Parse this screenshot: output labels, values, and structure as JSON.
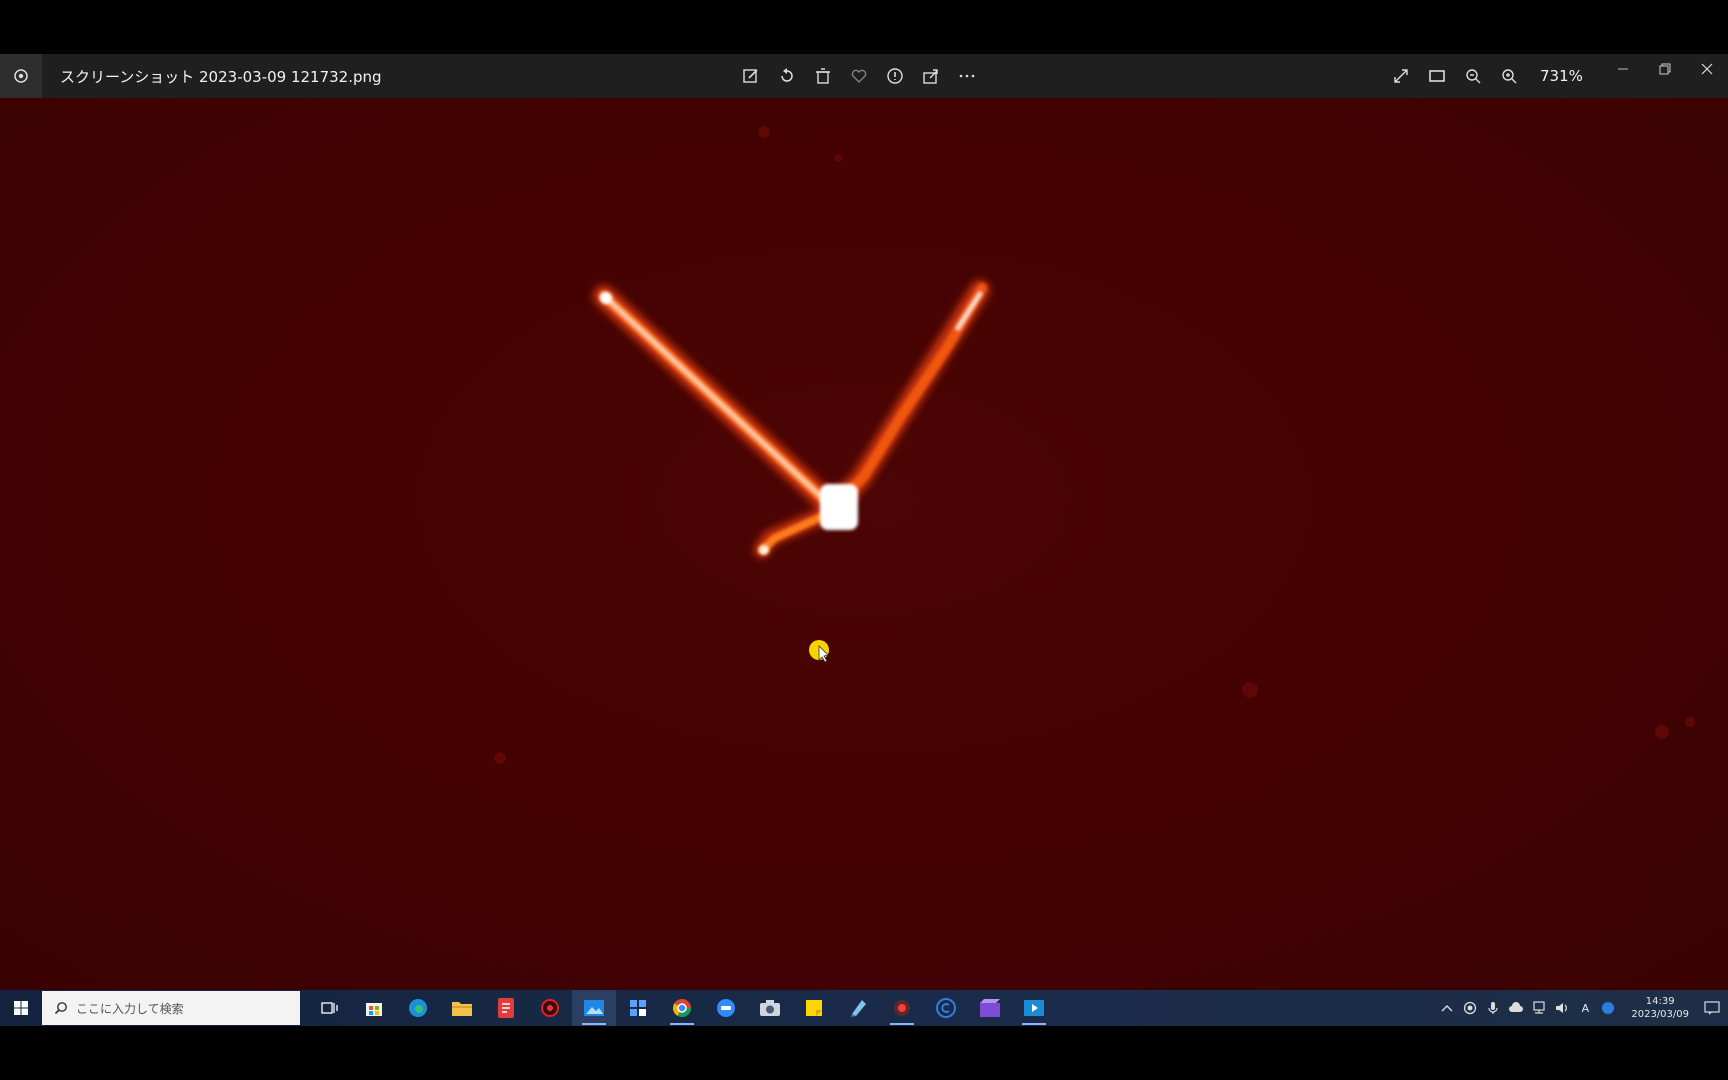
{
  "window": {
    "file_title": "スクリーンショット 2023-03-09 121732.png",
    "zoom": "731%"
  },
  "toolbar_icons": [
    "edit-icon",
    "rotate-icon",
    "delete-icon",
    "favorite-icon",
    "info-icon",
    "share-icon",
    "more-icon"
  ],
  "right_icons": [
    "fullscreen-icon",
    "fit-icon",
    "zoom-out-icon",
    "zoom-in-icon"
  ],
  "taskbar": {
    "search_placeholder": "ここに入力して検索",
    "time": "14:39",
    "date": "2023/03/09",
    "tray_lang": "A"
  },
  "colors": {
    "image_bg": "#430202",
    "streak": "#ff7a1a",
    "core": "#ffffff",
    "cursor": "#f5d400"
  }
}
